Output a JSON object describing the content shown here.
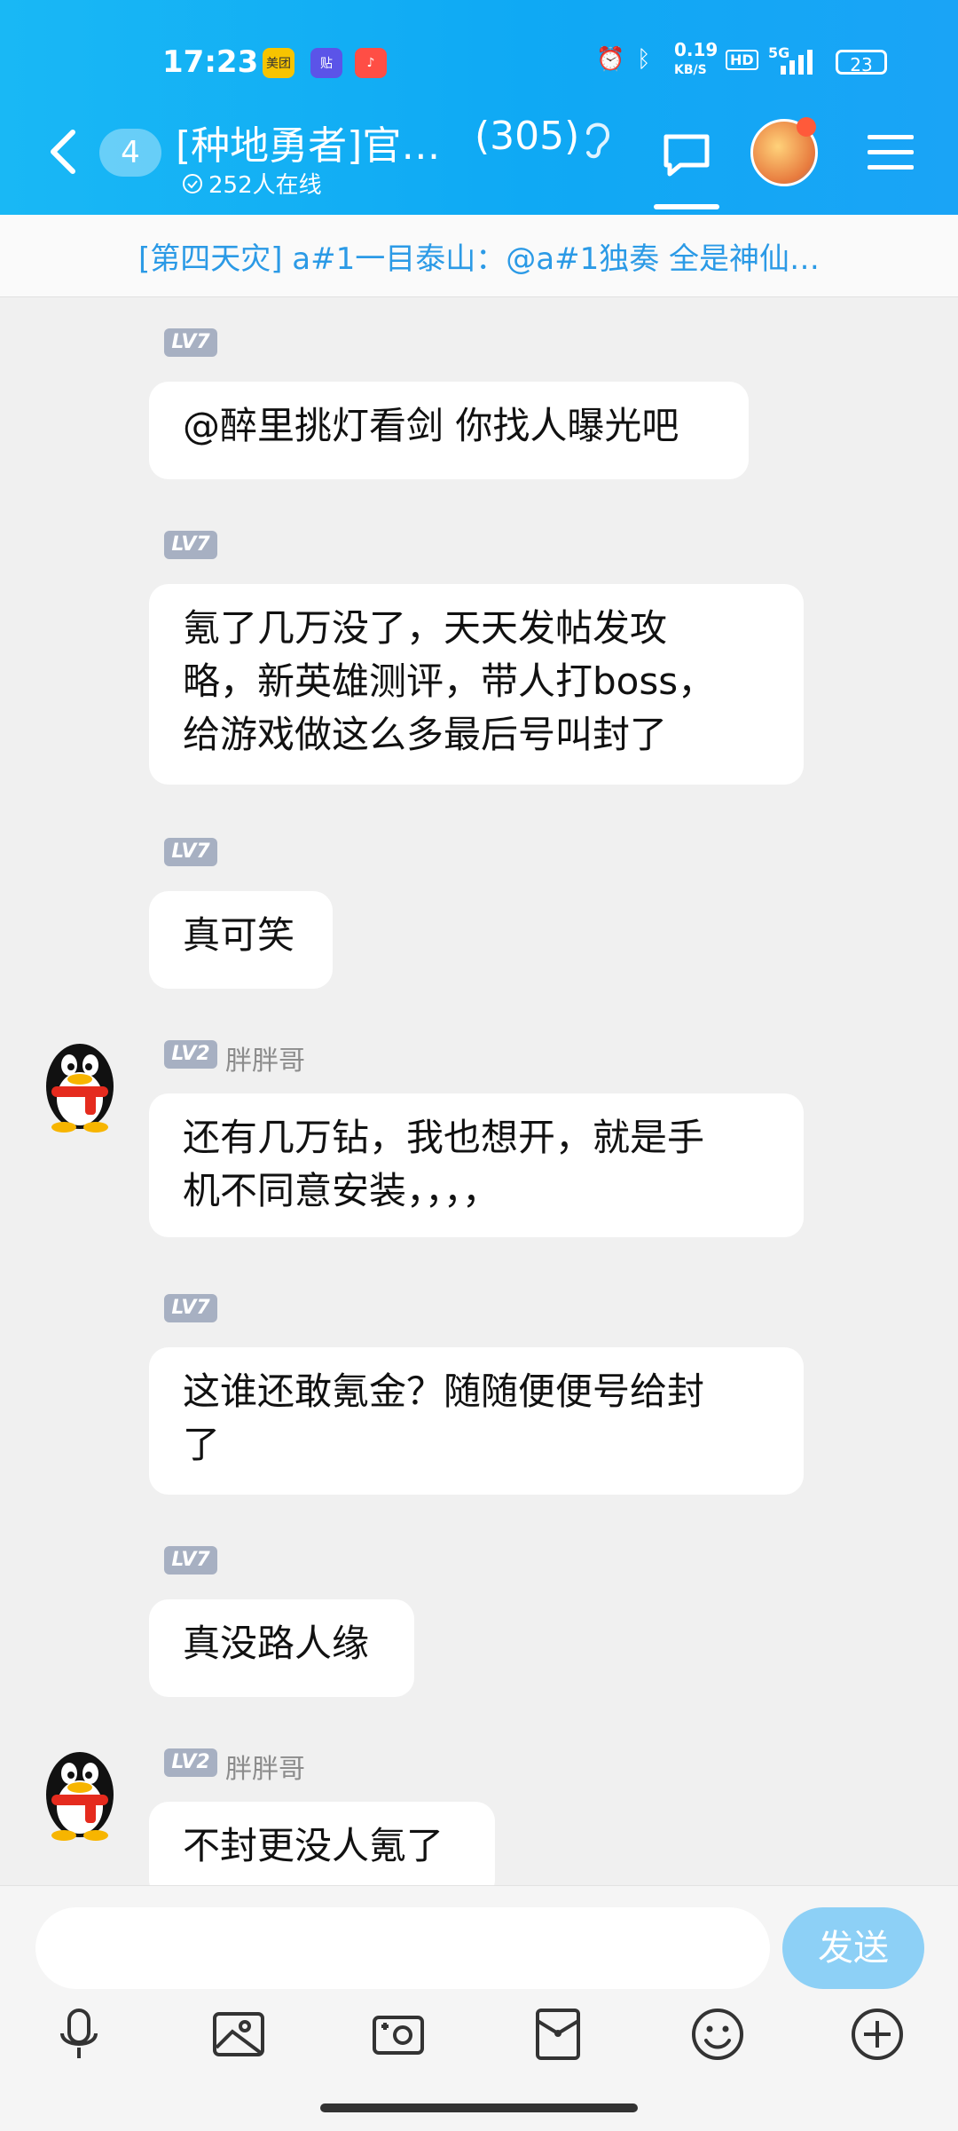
{
  "status_bar": {
    "time": "17:23",
    "app_icons": [
      "美团",
      "贴",
      "♪"
    ],
    "net_speed": "0.19",
    "net_unit": "KB/S",
    "hd": "HD",
    "network": "5G",
    "battery": "23"
  },
  "header": {
    "unread_count": "4",
    "group_name": "[种地勇者]官…",
    "member_count": "(305)",
    "online_text": "252人在线"
  },
  "notice": {
    "text": "[第四天灾] a#1一目泰山：@a#1独奏 全是神仙…"
  },
  "messages": [
    {
      "level": "LV7",
      "nickname": "",
      "has_avatar": false,
      "text": "@醉里挑灯看剑 你找人曝光吧"
    },
    {
      "level": "LV7",
      "nickname": "",
      "has_avatar": false,
      "text": "氪了几万没了，天天发帖发攻\n略，新英雄测评，带人打boss，\n给游戏做这么多最后号叫封了"
    },
    {
      "level": "LV7",
      "nickname": "",
      "has_avatar": false,
      "text": "真可笑"
    },
    {
      "level": "LV2",
      "nickname": "胖胖哥",
      "has_avatar": true,
      "text": "还有几万钻，我也想开，就是手\n机不同意安装，，，，"
    },
    {
      "level": "LV7",
      "nickname": "",
      "has_avatar": false,
      "text": "这谁还敢氪金？随随便便号给封\n了"
    },
    {
      "level": "LV7",
      "nickname": "",
      "has_avatar": false,
      "text": "真没路人缘"
    },
    {
      "level": "LV2",
      "nickname": "胖胖哥",
      "has_avatar": true,
      "text": "不封更没人氪了"
    }
  ],
  "input": {
    "placeholder": "",
    "send_label": "发送"
  },
  "toolbar": [
    "mic-icon",
    "image-icon",
    "camera-icon",
    "red-packet-icon",
    "emoji-icon",
    "plus-icon"
  ]
}
